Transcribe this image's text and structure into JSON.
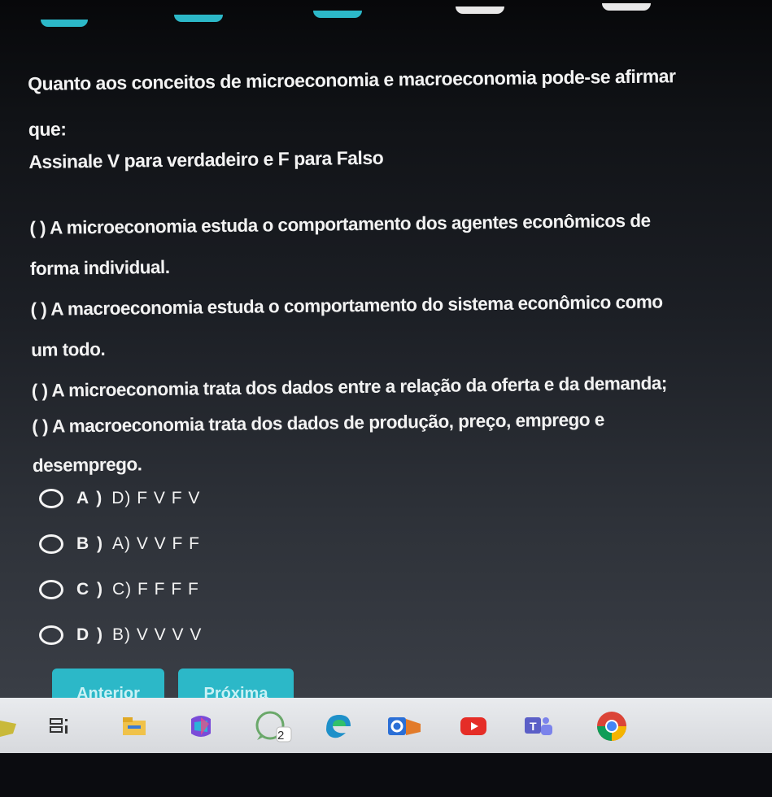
{
  "progress_marks": [
    {
      "color": "#2cb8c8"
    },
    {
      "color": "#2cb8c8"
    },
    {
      "color": "#2cb8c8"
    },
    {
      "color": "#e8e8e8"
    },
    {
      "color": "#e8e8e8"
    }
  ],
  "question": {
    "title_line1": "Quanto aos conceitos de microeconomia e macroeconomia pode-se afirmar",
    "title_line2": "que:",
    "instruction": "Assinale V para verdadeiro e F para Falso",
    "statements": [
      {
        "line1": "( ) A microeconomia estuda o comportamento dos agentes econômicos de",
        "line2": "forma individual."
      },
      {
        "line1": "( ) A macroeconomia estuda o comportamento do sistema econômico como",
        "line2": "um todo."
      },
      {
        "line1": "( ) A microeconomia trata dos dados entre a relação da oferta e da demanda;",
        "line2": ""
      },
      {
        "line1": "( ) A macroeconomia trata dos dados de produção, preço, emprego e",
        "line2": "desemprego."
      }
    ]
  },
  "options": [
    {
      "letter": "A )",
      "text": "D) F V F V"
    },
    {
      "letter": "B )",
      "text": "A) V V F F"
    },
    {
      "letter": "C )",
      "text": "C) F F F F"
    },
    {
      "letter": "D )",
      "text": "B) V V V V"
    }
  ],
  "navigation": {
    "previous_label": "Anterior",
    "next_label": "Próxima"
  },
  "taskbar": {
    "whatsapp_badge": "2",
    "icons": [
      "task-view-icon",
      "file-explorer-icon",
      "office-icon",
      "whatsapp-icon",
      "edge-icon",
      "office-online-icon",
      "youtube-icon",
      "teams-icon",
      "chrome-icon"
    ]
  }
}
